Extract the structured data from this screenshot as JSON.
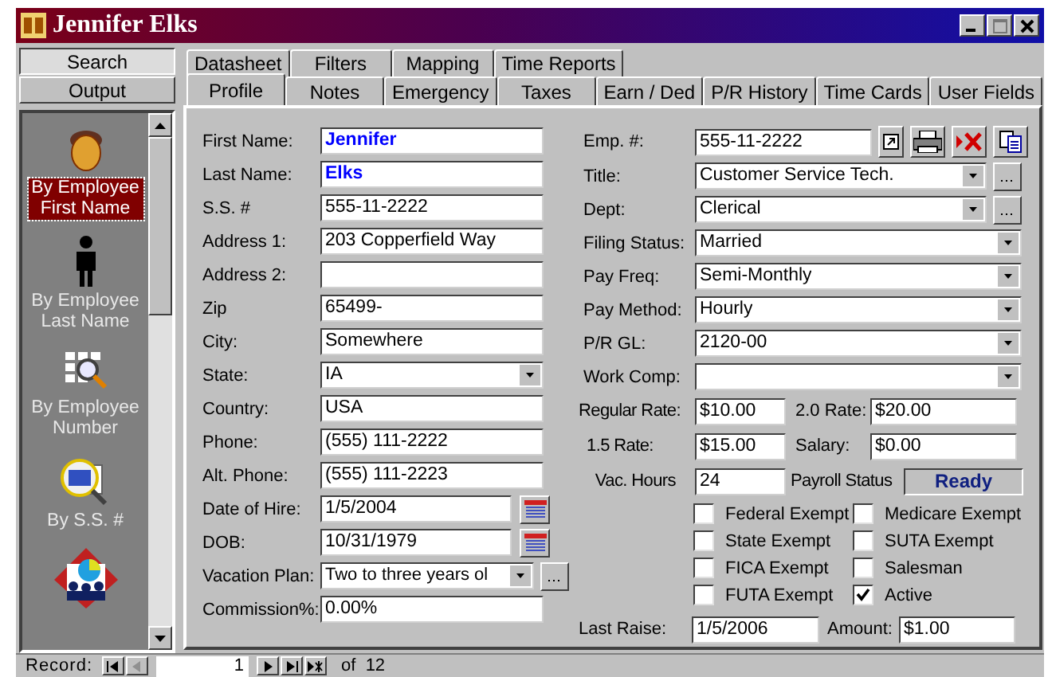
{
  "window": {
    "title": "Jennifer Elks"
  },
  "sidebar": {
    "buttons": [
      {
        "label": "Search",
        "selected": true
      },
      {
        "label": "Output",
        "selected": false
      }
    ],
    "items": [
      {
        "label": "By Employee First Name",
        "selected": true
      },
      {
        "label": "By Employee Last Name",
        "selected": false
      },
      {
        "label": "By Employee Number",
        "selected": false
      },
      {
        "label": "By S.S. #",
        "selected": false
      }
    ]
  },
  "tabs": {
    "row_1": [
      {
        "label": "Datasheet",
        "selected": false
      },
      {
        "label": "Filters",
        "selected": false
      },
      {
        "label": "Mapping",
        "selected": false
      },
      {
        "label": "Time Reports",
        "selected": false
      }
    ],
    "row_2": [
      {
        "label": "Profile",
        "selected": true
      },
      {
        "label": "Notes",
        "selected": false
      },
      {
        "label": "Emergency",
        "selected": false
      },
      {
        "label": "Taxes",
        "selected": false
      },
      {
        "label": "Earn / Ded",
        "selected": false
      },
      {
        "label": "P/R History",
        "selected": false
      },
      {
        "label": "Time Cards",
        "selected": false
      },
      {
        "label": "User Fields",
        "selected": false
      }
    ]
  },
  "profile": {
    "left_fields": [
      {
        "label": "First Name:",
        "value": "Jennifer",
        "kind": "text",
        "emphasized": true
      },
      {
        "label": "Last Name:",
        "value": "Elks",
        "kind": "text",
        "emphasized": true
      },
      {
        "label": "S.S. #",
        "value": "555-11-2222",
        "kind": "text",
        "emphasized": false
      },
      {
        "label": "Address 1:",
        "value": "203 Copperfield Way",
        "kind": "text",
        "emphasized": false
      },
      {
        "label": "Address 2:",
        "kind": "text"
      },
      {
        "label": "Zip",
        "value": "65499-",
        "kind": "text",
        "emphasized": false
      },
      {
        "label": "City:",
        "value": "Somewhere",
        "kind": "text",
        "emphasized": false
      },
      {
        "label": "State:",
        "value": "IA",
        "kind": "select",
        "emphasized": false
      },
      {
        "label": "Country:",
        "value": "USA",
        "kind": "text",
        "emphasized": false
      },
      {
        "label": "Phone:",
        "value": "(555) 111-2222",
        "kind": "text",
        "emphasized": false
      },
      {
        "label": "Alt. Phone:",
        "value": "(555) 111-2223",
        "kind": "text",
        "emphasized": false
      },
      {
        "label": "Date of Hire:",
        "value": "1/5/2004",
        "kind": "date",
        "emphasized": false
      },
      {
        "label": "DOB:",
        "value": "10/31/1979",
        "kind": "date",
        "emphasized": false
      },
      {
        "label": "Vacation Plan:",
        "value": "Two to three years ol",
        "kind": "select_more",
        "emphasized": false
      },
      {
        "label": "Commission%:",
        "value": "0.00%",
        "kind": "text",
        "emphasized": false
      }
    ],
    "employee_number": {
      "label": "Emp. #:",
      "value": "555-11-2222"
    },
    "right_fields": [
      {
        "label": "Title:",
        "value": "Customer Service Tech.",
        "kind": "select_more"
      },
      {
        "label": "Dept:",
        "value": "Clerical",
        "kind": "select_more"
      },
      {
        "label": "Filing Status:",
        "value": "Married",
        "kind": "select"
      },
      {
        "label": "Pay Freq:",
        "value": "Semi-Monthly",
        "kind": "select"
      },
      {
        "label": "Pay Method:",
        "value": "Hourly",
        "kind": "select"
      },
      {
        "label": "P/R  GL:",
        "value": "2120-00",
        "kind": "select"
      },
      {
        "label": "Work Comp:",
        "kind": "select"
      }
    ],
    "rates": [
      {
        "label": "Regular Rate:",
        "value": "$10.00"
      },
      {
        "label": "2.0 Rate:",
        "value": "$20.00"
      },
      {
        "label": "1.5 Rate:",
        "value": "$15.00"
      },
      {
        "label": "Salary:",
        "value": "$0.00"
      }
    ],
    "vacation_hours": {
      "label": "Vac. Hours",
      "value": "24"
    },
    "payroll_status": {
      "label": "Payroll Status",
      "value": "Ready"
    },
    "flags": [
      {
        "label": "Federal Exempt",
        "checked": false
      },
      {
        "label": "Medicare Exempt",
        "checked": false
      },
      {
        "label": "State Exempt",
        "checked": false
      },
      {
        "label": "SUTA Exempt",
        "checked": false
      },
      {
        "label": "FICA Exempt",
        "checked": false
      },
      {
        "label": "Salesman",
        "checked": false
      },
      {
        "label": "FUTA Exempt",
        "checked": false
      },
      {
        "label": "Active",
        "checked": true
      }
    ],
    "last_raise": {
      "label": "Last Raise:",
      "value": "1/5/2006"
    },
    "amount": {
      "label": "Amount:",
      "value": "$1.00"
    }
  },
  "record_bar": {
    "label": "Record:",
    "current": "1",
    "total": "of  12",
    "buttons": [
      {
        "kind": "first",
        "disabled": false
      },
      {
        "kind": "previous",
        "disabled": true
      },
      {
        "kind": "next",
        "disabled": false
      },
      {
        "kind": "last",
        "disabled": false
      },
      {
        "kind": "new",
        "disabled": false
      }
    ]
  }
}
